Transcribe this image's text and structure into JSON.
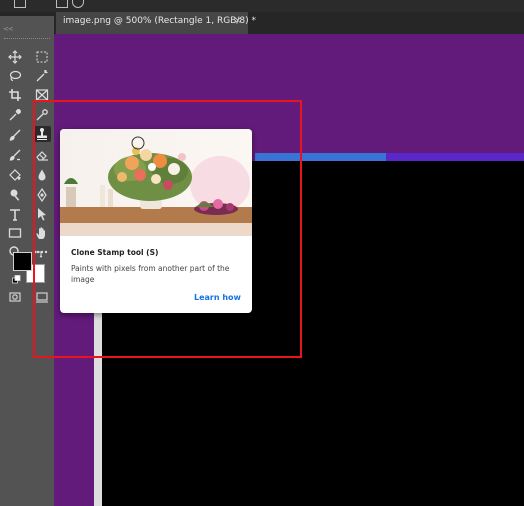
{
  "document_tab": {
    "title": "image.png @ 500% (Rectangle 1, RGB/8) *",
    "close": "×"
  },
  "toolbar": {
    "collapse_glyph": "<<",
    "tools": [
      {
        "id": "move",
        "icon": "move-icon",
        "active": false
      },
      {
        "id": "artboard",
        "icon": "artboard-icon",
        "active": false
      },
      {
        "id": "lasso",
        "icon": "lasso-icon",
        "active": false
      },
      {
        "id": "magic-wand",
        "icon": "magic-wand-icon",
        "active": false
      },
      {
        "id": "crop",
        "icon": "crop-icon",
        "active": false
      },
      {
        "id": "frame",
        "icon": "frame-icon",
        "active": false
      },
      {
        "id": "eyedropper",
        "icon": "eyedropper-icon",
        "active": false
      },
      {
        "id": "spot-healing",
        "icon": "spot-healing-brush-icon",
        "active": false
      },
      {
        "id": "brush",
        "icon": "brush-icon",
        "active": false
      },
      {
        "id": "clone-stamp",
        "icon": "clone-stamp-icon",
        "active": true
      },
      {
        "id": "history-brush",
        "icon": "history-brush-icon",
        "active": false
      },
      {
        "id": "eraser",
        "icon": "eraser-icon",
        "active": false
      },
      {
        "id": "paint-bucket",
        "icon": "paint-bucket-icon",
        "active": false
      },
      {
        "id": "blur",
        "icon": "blur-icon",
        "active": false
      },
      {
        "id": "dodge",
        "icon": "dodge-icon",
        "active": false
      },
      {
        "id": "pen",
        "icon": "pen-icon",
        "active": false
      },
      {
        "id": "type",
        "icon": "type-icon",
        "active": false
      },
      {
        "id": "path-selection",
        "icon": "path-selection-icon",
        "active": false
      },
      {
        "id": "rectangle",
        "icon": "rectangle-icon",
        "active": false
      },
      {
        "id": "hand",
        "icon": "hand-icon",
        "active": false
      },
      {
        "id": "zoom",
        "icon": "zoom-icon",
        "active": false
      },
      {
        "id": "more",
        "icon": "more-icon",
        "active": false
      },
      {
        "id": "quick-mask",
        "icon": "quick-mask-icon",
        "active": false
      },
      {
        "id": "screen-mode",
        "icon": "screen-mode-icon",
        "active": false
      }
    ],
    "foreground_color": "#000000",
    "background_color": "#ffffff"
  },
  "tooltip": {
    "title": "Clone Stamp tool (S)",
    "description": "Paints with pixels from another part of the image",
    "link": "Learn how",
    "image": "flower-arrangement-illustration"
  },
  "colors": {
    "canvas_purple": "#621b7a",
    "highlight_red": "#e8141e",
    "link_blue": "#1473e6"
  }
}
